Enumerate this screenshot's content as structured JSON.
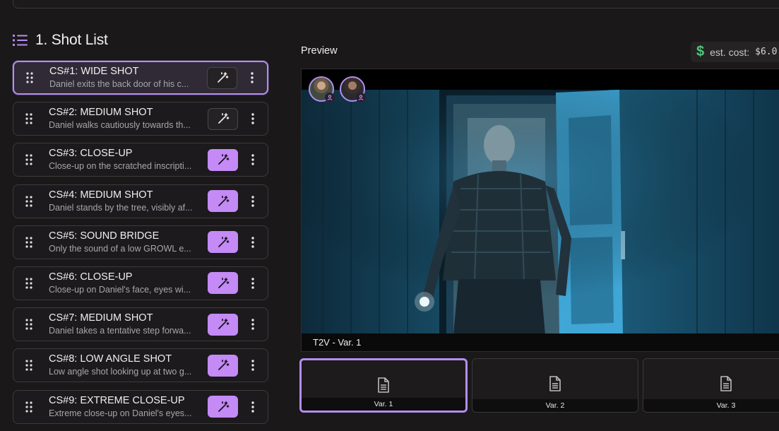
{
  "shot_list": {
    "title": "1. Shot List",
    "items": [
      {
        "title": "CS#1: WIDE SHOT",
        "desc": "Daniel exits the back door of his c..."
      },
      {
        "title": "CS#2: MEDIUM SHOT",
        "desc": "Daniel walks cautiously towards th..."
      },
      {
        "title": "CS#3: CLOSE-UP",
        "desc": "Close-up on the scratched inscripti..."
      },
      {
        "title": "CS#4: MEDIUM SHOT",
        "desc": "Daniel stands by the tree, visibly af..."
      },
      {
        "title": "CS#5: SOUND BRIDGE",
        "desc": "Only the sound of a low GROWL e..."
      },
      {
        "title": "CS#6: CLOSE-UP",
        "desc": "Close-up on Daniel's face, eyes wi..."
      },
      {
        "title": "CS#7: MEDIUM SHOT",
        "desc": "Daniel takes a tentative step forwa..."
      },
      {
        "title": "CS#8: LOW ANGLE SHOT",
        "desc": "Low angle shot looking up at two g..."
      },
      {
        "title": "CS#9: EXTREME CLOSE-UP",
        "desc": "Extreme close-up on Daniel's eyes..."
      }
    ]
  },
  "preview": {
    "label": "Preview",
    "caption": "T2V - Var. 1"
  },
  "cost": {
    "icon": "$",
    "label": "est. cost:",
    "value": "$6.0"
  },
  "variations": [
    "Var. 1",
    "Var. 2",
    "Var. 3"
  ],
  "colors": {
    "accent": "#b48ef0",
    "magic_button": "#c48af5",
    "cost_icon": "#4ec97a"
  }
}
